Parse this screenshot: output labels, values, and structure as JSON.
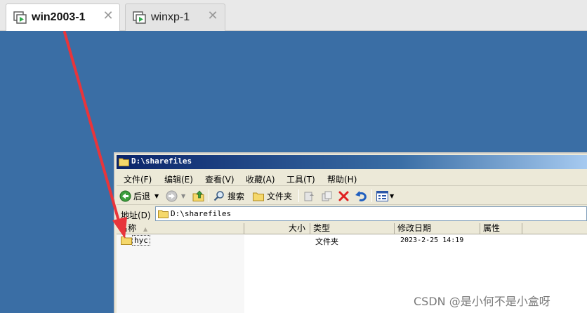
{
  "vm_tabs": [
    {
      "label": "win2003-1",
      "active": true
    },
    {
      "label": "winxp-1",
      "active": false
    }
  ],
  "window": {
    "title": "D:\\sharefiles",
    "menu": [
      "文件(F)",
      "编辑(E)",
      "查看(V)",
      "收藏(A)",
      "工具(T)",
      "帮助(H)"
    ],
    "toolbar": {
      "back_label": "后退",
      "search_label": "搜索",
      "folders_label": "文件夹"
    },
    "address": {
      "label": "地址(D)",
      "value": "D:\\sharefiles"
    },
    "columns": [
      "名称",
      "大小",
      "类型",
      "修改日期",
      "属性"
    ],
    "rows": [
      {
        "name": "hyc",
        "size": "",
        "type": "文件夹",
        "modified": "2023-2-25 14:19",
        "attrs": ""
      }
    ]
  },
  "watermark": "CSDN @是小何不是小盒呀",
  "colors": {
    "desktop": "#3a6ea5",
    "titlebar_start": "#0a246a",
    "annotation_arrow": "#e8353b"
  }
}
